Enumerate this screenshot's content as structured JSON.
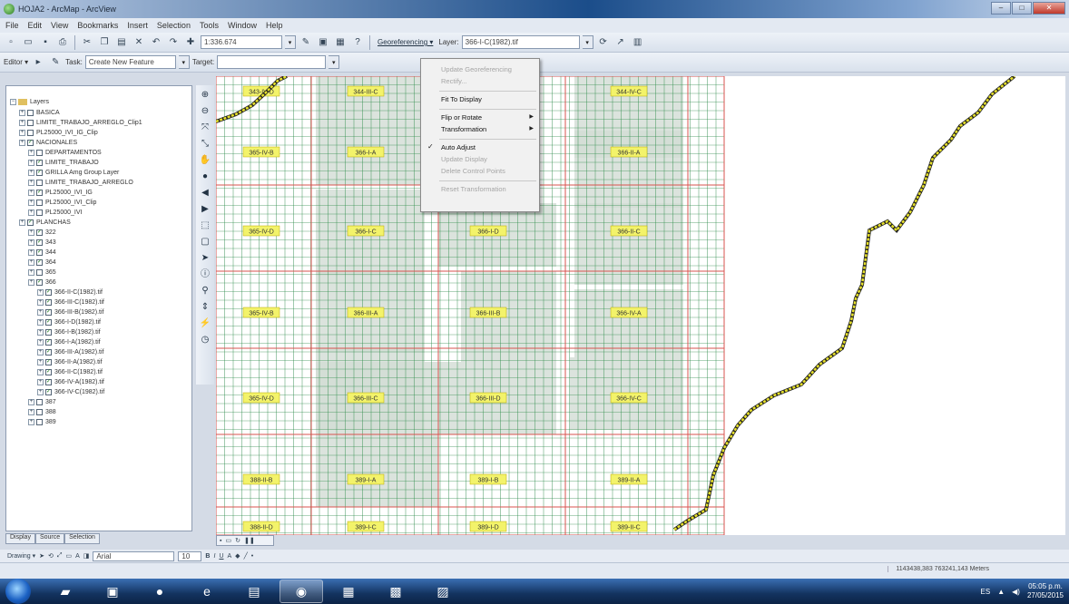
{
  "window": {
    "title": "HOJA2 - ArcMap - ArcView",
    "min": "–",
    "max": "□",
    "close": "✕"
  },
  "menu": [
    "File",
    "Edit",
    "View",
    "Bookmarks",
    "Insert",
    "Selection",
    "Tools",
    "Window",
    "Help"
  ],
  "toolbar": {
    "scale": "1:336.674",
    "georeferencing": "Georeferencing ▾",
    "layer_label": "Layer:",
    "layer_value": "366-I-C(1982).tif",
    "editor": "Editor ▾",
    "task_label": "Task:",
    "task_value": "Create New Feature",
    "target_label": "Target:"
  },
  "toc": {
    "root": "Layers",
    "items": [
      {
        "label": "BASICA",
        "check": false,
        "indent": 1
      },
      {
        "label": "LIMITE_TRABAJO_ARREGLO_Clip1",
        "check": false,
        "indent": 1
      },
      {
        "label": "PL25000_IVI_IG_Clip",
        "check": false,
        "indent": 1
      },
      {
        "label": "NACIONALES",
        "check": true,
        "indent": 1
      },
      {
        "label": "DEPARTAMENTOS",
        "check": false,
        "indent": 2
      },
      {
        "label": "LIMITE_TRABAJO",
        "check": true,
        "indent": 2
      },
      {
        "label": "GRILLA Amg Group Layer",
        "check": true,
        "indent": 2
      },
      {
        "label": "LIMITE_TRABAJO_ARREGLO",
        "check": false,
        "indent": 2
      },
      {
        "label": "PL25000_IVI_IG",
        "check": true,
        "indent": 2
      },
      {
        "label": "PL25000_IVI_Clip",
        "check": false,
        "indent": 2
      },
      {
        "label": "PL25000_IVI",
        "check": false,
        "indent": 2
      },
      {
        "label": "PLANCHAS",
        "check": true,
        "indent": 1
      },
      {
        "label": "322",
        "check": true,
        "indent": 2
      },
      {
        "label": "343",
        "check": true,
        "indent": 2
      },
      {
        "label": "344",
        "check": true,
        "indent": 2
      },
      {
        "label": "364",
        "check": true,
        "indent": 2
      },
      {
        "label": "365",
        "check": false,
        "indent": 2
      },
      {
        "label": "366",
        "check": true,
        "indent": 2
      },
      {
        "label": "366-II-C(1982).tif",
        "check": true,
        "indent": 3
      },
      {
        "label": "366-III-C(1982).tif",
        "check": true,
        "indent": 3
      },
      {
        "label": "366-III-B(1982).tif",
        "check": true,
        "indent": 3
      },
      {
        "label": "366-I-D(1982).tif",
        "check": true,
        "indent": 3
      },
      {
        "label": "366-I-B(1982).tif",
        "check": true,
        "indent": 3
      },
      {
        "label": "366-I-A(1982).tif",
        "check": true,
        "indent": 3
      },
      {
        "label": "366-III-A(1982).tif",
        "check": true,
        "indent": 3
      },
      {
        "label": "366-II-A(1982).tif",
        "check": true,
        "indent": 3
      },
      {
        "label": "366-II-C(1982).tif",
        "check": true,
        "indent": 3
      },
      {
        "label": "366-IV-A(1982).tif",
        "check": true,
        "indent": 3
      },
      {
        "label": "366-IV-C(1982).tif",
        "check": true,
        "indent": 3
      },
      {
        "label": "387",
        "check": false,
        "indent": 2
      },
      {
        "label": "388",
        "check": false,
        "indent": 2
      },
      {
        "label": "389",
        "check": false,
        "indent": 2
      }
    ]
  },
  "toc_tabs": [
    "Display",
    "Source",
    "Selection"
  ],
  "georef_menu": [
    {
      "label": "Update Georeferencing",
      "disabled": true
    },
    {
      "label": "Rectify...",
      "disabled": true
    },
    {
      "sep": true
    },
    {
      "label": "Fit To Display",
      "disabled": false
    },
    {
      "sep": true
    },
    {
      "label": "Flip or Rotate",
      "disabled": false,
      "submenu": true
    },
    {
      "label": "Transformation",
      "disabled": false,
      "submenu": true
    },
    {
      "sep": true
    },
    {
      "label": "Auto Adjust",
      "disabled": false,
      "checked": true
    },
    {
      "label": "Update Display",
      "disabled": true
    },
    {
      "label": "Delete Control Points",
      "disabled": true
    },
    {
      "sep": true
    },
    {
      "label": "Reset Transformation",
      "disabled": true
    }
  ],
  "map_labels": [
    {
      "text": "343-IV-D",
      "col": 0,
      "row": 0
    },
    {
      "text": "344-III-C",
      "col": 1,
      "row": 0
    },
    {
      "text": "344-IV-C",
      "col": 3,
      "row": 0
    },
    {
      "text": "365-IV-B",
      "col": 0,
      "row": 1
    },
    {
      "text": "366-I-A",
      "col": 1,
      "row": 1
    },
    {
      "text": "366-II-A",
      "col": 3,
      "row": 1
    },
    {
      "text": "365-IV-D",
      "col": 0,
      "row": 2
    },
    {
      "text": "366-I-C",
      "col": 1,
      "row": 2
    },
    {
      "text": "366-I-D",
      "col": 2,
      "row": 2
    },
    {
      "text": "366-II-C",
      "col": 3,
      "row": 2
    },
    {
      "text": "365-IV-B",
      "col": 0,
      "row": 3
    },
    {
      "text": "366-III-A",
      "col": 1,
      "row": 3
    },
    {
      "text": "366-III-B",
      "col": 2,
      "row": 3
    },
    {
      "text": "366-IV-A",
      "col": 3,
      "row": 3
    },
    {
      "text": "365-IV-D",
      "col": 0,
      "row": 4
    },
    {
      "text": "366-III-C",
      "col": 1,
      "row": 4
    },
    {
      "text": "366-III-D",
      "col": 2,
      "row": 4
    },
    {
      "text": "366-IV-C",
      "col": 3,
      "row": 4
    },
    {
      "text": "388-II-B",
      "col": 0,
      "row": 5
    },
    {
      "text": "389-I-A",
      "col": 1,
      "row": 5
    },
    {
      "text": "389-I-B",
      "col": 2,
      "row": 5
    },
    {
      "text": "389-II-A",
      "col": 3,
      "row": 5
    },
    {
      "text": "388-II-D",
      "col": 0,
      "row": 6
    },
    {
      "text": "389-I-C",
      "col": 1,
      "row": 6
    },
    {
      "text": "389-I-D",
      "col": 2,
      "row": 6
    },
    {
      "text": "389-II-C",
      "col": 3,
      "row": 6
    }
  ],
  "drawing": {
    "label": "Drawing ▾",
    "font": "Arial",
    "size": "10"
  },
  "status": {
    "coords": "1143438,383  763241,143 Meters"
  },
  "tray": {
    "time": "05:05 p.m.",
    "date": "27/05/2015"
  },
  "colors": {
    "grid": "#2e8b4a",
    "sheet_border": "#d9534f",
    "label_bg": "#f3f36a",
    "boundary": "#e6e02a"
  }
}
